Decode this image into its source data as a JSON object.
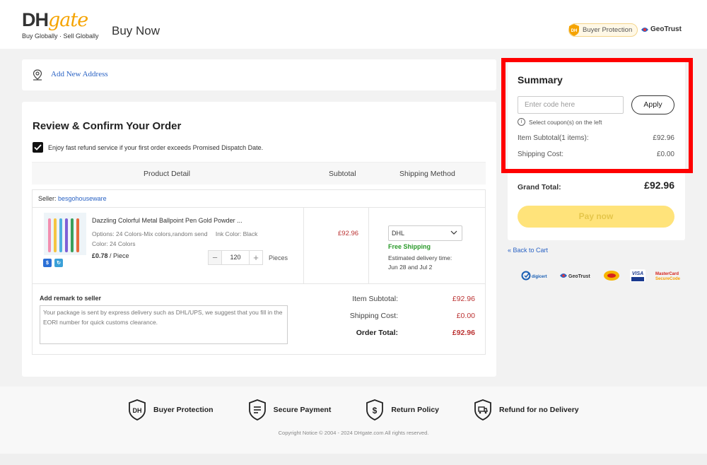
{
  "header": {
    "logo_dh": "DH",
    "logo_gate": "gate",
    "logo_tagline": "Buy Globally · Sell Globally",
    "page_title": "Buy Now",
    "buyer_protection": "Buyer Protection",
    "geotrust": "GeoTrust"
  },
  "address": {
    "add_link": "Add New Address"
  },
  "order": {
    "title": "Review & Confirm Your Order",
    "refund_text": "Enjoy fast refund service if your first order exceeds Promised Dispatch Date.",
    "columns": {
      "product": "Product Detail",
      "subtotal": "Subtotal",
      "shipping": "Shipping Method"
    },
    "seller_label": "Seller:",
    "seller_name": "besgohouseware",
    "product": {
      "title": "Dazzling Colorful Metal Ballpoint Pen Gold Powder ...",
      "options_label": "Options:",
      "options_value": "24 Colors-Mix colors,random send",
      "ink_label": "Ink Color:",
      "ink_value": "Black",
      "color_label": "Color:",
      "color_value": "24 Colors",
      "unit_price": "£0.78",
      "unit_suffix": "/ Piece",
      "quantity": "120",
      "quantity_unit": "Pieces",
      "subtotal": "£92.96",
      "shipping_method": "DHL",
      "free_shipping": "Free Shipping",
      "estimated_label": "Estimated delivery time:",
      "estimated_dates": "Jun 28 and Jul 2"
    },
    "remark_title": "Add remark to seller",
    "remark_placeholder": "Your package is sent by express delivery such as DHL/UPS, we suggest that you fill in the EORI number for quick customs clearance.",
    "totals": {
      "item_subtotal_label": "Item Subtotal:",
      "item_subtotal": "£92.96",
      "shipping_label": "Shipping Cost:",
      "shipping": "£0.00",
      "order_total_label": "Order Total:",
      "order_total": "£92.96"
    }
  },
  "summary": {
    "title": "Summary",
    "coupon_placeholder": "Enter code here",
    "apply": "Apply",
    "coupon_hint": "Select coupon(s) on the left",
    "item_subtotal_label": "Item Subtotal(1 items):",
    "item_subtotal": "£92.96",
    "shipping_label": "Shipping Cost:",
    "shipping": "£0.00",
    "grand_total_label": "Grand Total:",
    "grand_total": "£92.96",
    "pay_now": "Pay now",
    "back_to_cart": "« Back to Cart",
    "trust_badges": [
      "digicert",
      "GeoTrust",
      "MasterCard SecureCode"
    ]
  },
  "footer": {
    "items": [
      "Buyer Protection",
      "Secure Payment",
      "Return Policy",
      "Refund for no Delivery"
    ],
    "copyright": "Copyright Notice © 2004 - 2024 DHgate.com All rights reserved."
  },
  "colors": {
    "brand_orange": "#f5a300",
    "link_blue": "#2962c4",
    "price_red": "#b33333",
    "pay_yellow": "#ffe37a",
    "highlight_red": "#ff0000"
  }
}
